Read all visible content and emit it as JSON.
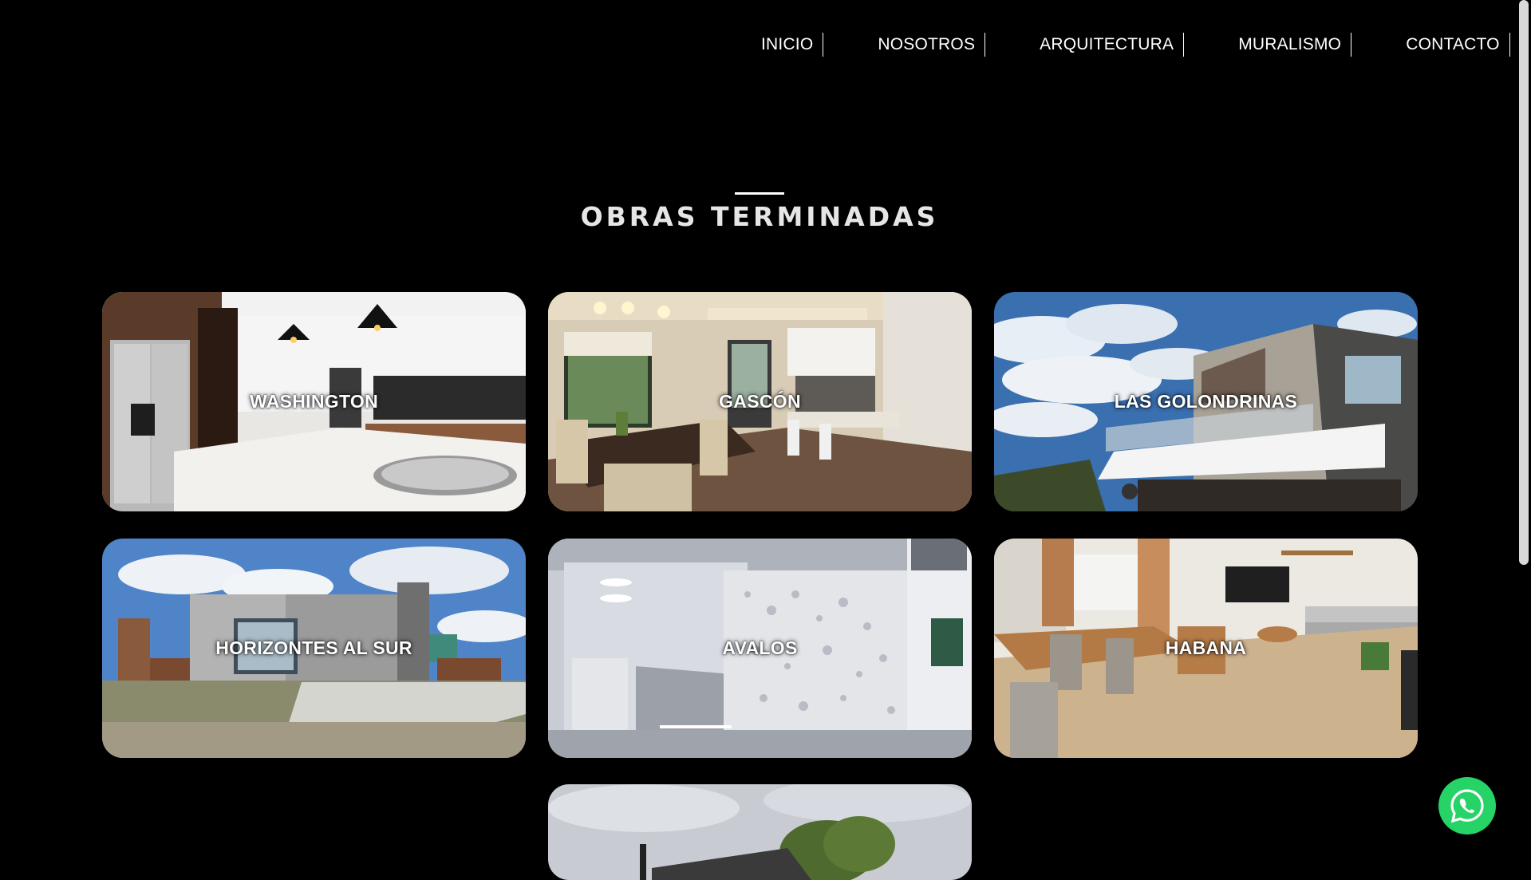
{
  "nav": {
    "items": [
      {
        "label": "INICIO"
      },
      {
        "label": "NOSOTROS"
      },
      {
        "label": "ARQUITECTURA"
      },
      {
        "label": "MURALISMO"
      },
      {
        "label": "CONTACTO"
      }
    ]
  },
  "section": {
    "title": "OBRAS TERMINADAS"
  },
  "projects": [
    {
      "name": "WASHINGTON"
    },
    {
      "name": "GASCÓN"
    },
    {
      "name": "LAS GOLONDRINAS"
    },
    {
      "name": "HORIZONTES AL SUR"
    },
    {
      "name": "AVALOS"
    },
    {
      "name": "HABANA"
    },
    {
      "name": ""
    }
  ],
  "colors": {
    "background": "#000000",
    "text": "#ffffff",
    "whatsapp": "#25d366"
  },
  "icons": {
    "whatsapp": "whatsapp-icon"
  }
}
